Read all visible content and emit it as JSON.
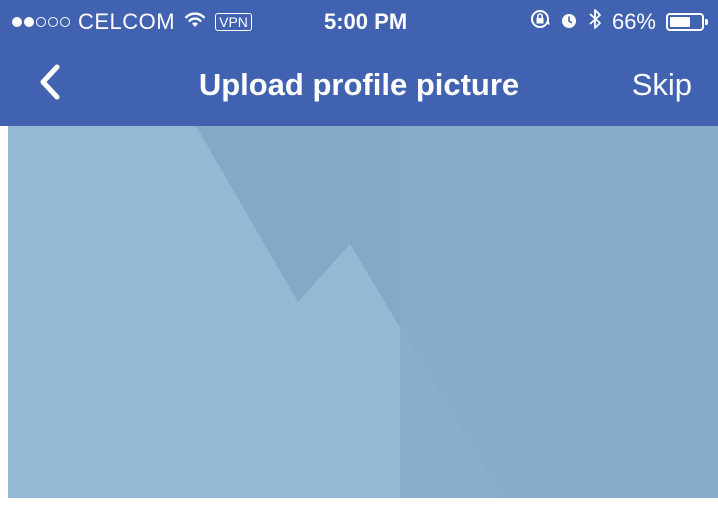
{
  "status_bar": {
    "signal_bars_filled": 2,
    "signal_bars_total": 5,
    "carrier": "CELCOM",
    "vpn_label": "VPN",
    "time": "5:00 PM",
    "battery_percent": "66%",
    "battery_level": 0.66,
    "icons": [
      "wifi-icon",
      "orientation-lock-icon",
      "alarm-icon",
      "bluetooth-icon",
      "battery-icon"
    ]
  },
  "nav": {
    "title": "Upload profile picture",
    "back_icon": "chevron-left-icon",
    "skip_label": "Skip"
  },
  "colors": {
    "header_bg": "#4062b0",
    "placeholder_bg": "#93b9d5",
    "placeholder_shade": "#7fa8c5"
  }
}
